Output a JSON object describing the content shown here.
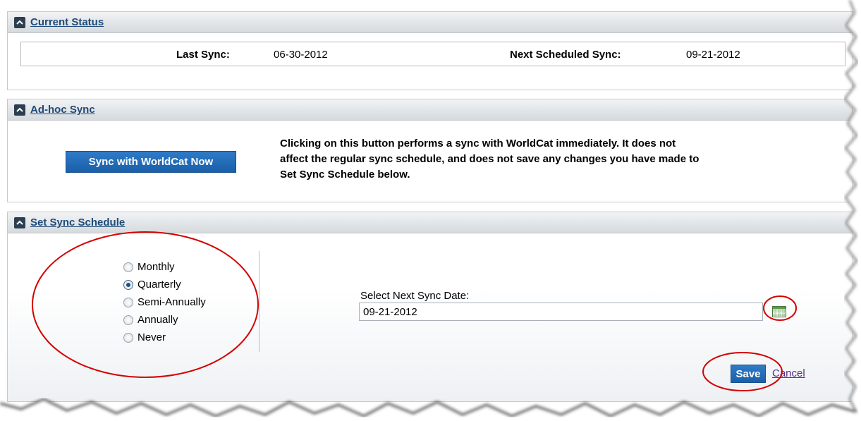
{
  "current_status": {
    "title": "Current Status",
    "last_sync_label": "Last Sync:",
    "last_sync_value": "06-30-2012",
    "next_sync_label": "Next Scheduled Sync:",
    "next_sync_value": "09-21-2012"
  },
  "adhoc_sync": {
    "title": "Ad-hoc Sync",
    "button_label": "Sync with WorldCat Now",
    "description": "Clicking on this button performs a sync with WorldCat immediately. It does not\naffect the regular sync schedule, and does not save any changes you have made to\nSet Sync Schedule below."
  },
  "set_schedule": {
    "title": "Set Sync Schedule",
    "frequency_options": [
      {
        "label": "Monthly",
        "checked": false
      },
      {
        "label": "Quarterly",
        "checked": true
      },
      {
        "label": "Semi-Annually",
        "checked": false
      },
      {
        "label": "Annually",
        "checked": false
      },
      {
        "label": "Never",
        "checked": false
      }
    ],
    "date_label": "Select Next Sync Date:",
    "date_value": "09-21-2012",
    "save_label": "Save",
    "cancel_label": "Cancel"
  },
  "colors": {
    "header_link": "#1f4b78",
    "button_blue": "#1a5fa8",
    "annotation_red": "#d40000",
    "cancel_link": "#5a2a8c"
  },
  "icons": {
    "collapse": "chevron-up-icon",
    "calendar": "calendar-icon"
  }
}
